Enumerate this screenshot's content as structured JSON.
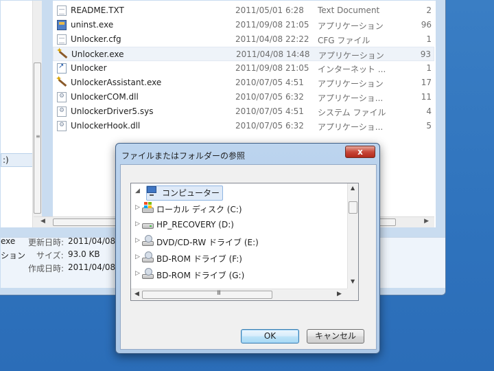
{
  "explorer": {
    "nav_item_fragment": ":)",
    "files": [
      {
        "name": "README.TXT",
        "date": "2011/05/01 6:28",
        "type": "Text Document",
        "size": "2",
        "icon": "text-file-icon"
      },
      {
        "name": "uninst.exe",
        "date": "2011/09/08 21:05",
        "type": "アプリケーション",
        "size": "96",
        "icon": "installer-icon"
      },
      {
        "name": "Unlocker.cfg",
        "date": "2011/04/08 22:22",
        "type": "CFG ファイル",
        "size": "1",
        "icon": "config-file-icon"
      },
      {
        "name": "Unlocker.exe",
        "date": "2011/04/08 14:48",
        "type": "アプリケーション",
        "size": "93",
        "icon": "magic-wand-icon",
        "selected": true
      },
      {
        "name": "Unlocker",
        "date": "2011/09/08 21:05",
        "type": "インターネット ...",
        "size": "1",
        "icon": "shortcut-icon"
      },
      {
        "name": "UnlockerAssistant.exe",
        "date": "2010/07/05 4:51",
        "type": "アプリケーション",
        "size": "17",
        "icon": "magic-wand-icon"
      },
      {
        "name": "UnlockerCOM.dll",
        "date": "2010/07/05 6:32",
        "type": "アプリケーショ...",
        "size": "11",
        "icon": "dll-file-icon"
      },
      {
        "name": "UnlockerDriver5.sys",
        "date": "2010/07/05 4:51",
        "type": "システム ファイル",
        "size": "4",
        "icon": "dll-file-icon"
      },
      {
        "name": "UnlockerHook.dll",
        "date": "2010/07/05 6:32",
        "type": "アプリケーショ...",
        "size": "5",
        "icon": "dll-file-icon"
      }
    ],
    "details": {
      "name_fragment": "exe",
      "type_fragment": "ション",
      "modified_label": "更新日時:",
      "modified_value": "2011/04/08",
      "size_label": "サイズ:",
      "size_value": "93.0 KB",
      "created_label": "作成日時:",
      "created_value": "2011/04/08"
    }
  },
  "dialog": {
    "title": "ファイルまたはフォルダーの参照",
    "close_label": "x",
    "tree": [
      {
        "label": "コンピューター",
        "icon": "computer-icon",
        "expander": "◢",
        "selected": true
      },
      {
        "label": "ローカル ディスク (C:)",
        "icon": "windows-drive-icon",
        "expander": "▷"
      },
      {
        "label": "HP_RECOVERY (D:)",
        "icon": "hard-drive-icon",
        "expander": "▷"
      },
      {
        "label": "DVD/CD-RW ドライブ (E:)",
        "icon": "optical-drive-icon",
        "expander": "▷"
      },
      {
        "label": "BD-ROM ドライブ (F:)",
        "icon": "optical-drive-icon",
        "expander": "▷"
      },
      {
        "label": "BD-ROM ドライブ (G:)",
        "icon": "optical-drive-icon",
        "expander": "▷"
      }
    ],
    "hscroll_grip": "III",
    "ok_label": "OK",
    "cancel_label": "キャンセル"
  }
}
